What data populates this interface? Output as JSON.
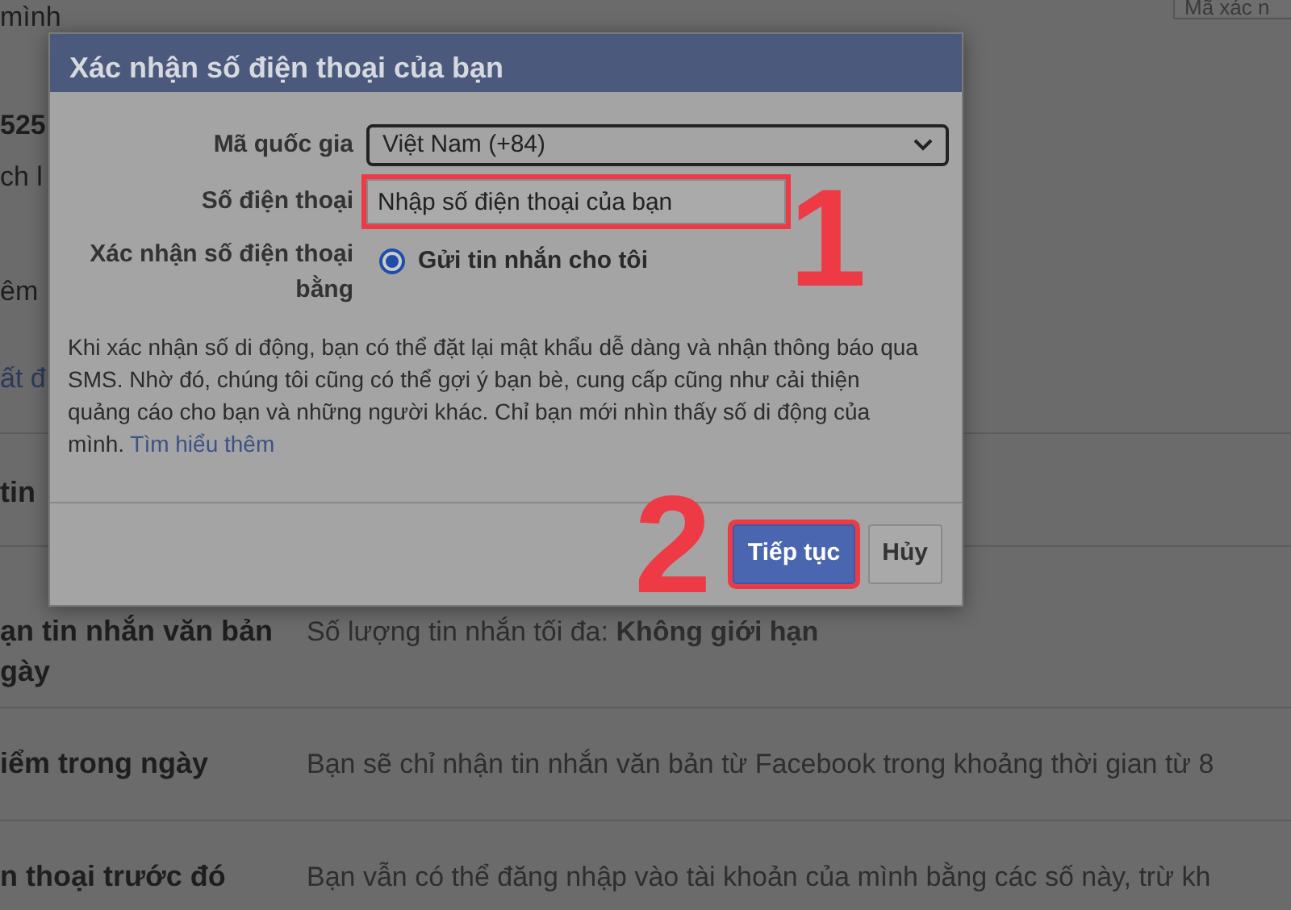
{
  "background": {
    "top_field": "Mã xác n",
    "fragments": [
      {
        "text": "mình",
        "kind": "plain"
      },
      {
        "text": "525",
        "kind": "bold"
      },
      {
        "text": "ch l",
        "kind": "plain"
      },
      {
        "text": "êm",
        "kind": "plain"
      },
      {
        "text": "ất đ",
        "kind": "link"
      }
    ],
    "rows": [
      {
        "label": "tin",
        "description": ""
      },
      {
        "label": "ạn tin nhắn văn bản\ngày",
        "description": "Số lượng tin nhắn tối đa: **Không giới hạn**"
      },
      {
        "label": "iểm trong ngày",
        "description": "Bạn sẽ chỉ nhận tin nhắn văn bản từ Facebook trong khoảng thời gian từ 8"
      },
      {
        "label": "n thoại trước đó",
        "description": "Bạn vẫn có thể đăng nhập vào tài khoản của mình bằng các số này, trừ kh"
      }
    ]
  },
  "dialog": {
    "title": "Xác nhận số điện thoại của bạn",
    "country": {
      "label": "Mã quốc gia",
      "value": "Việt Nam (+84)"
    },
    "phone": {
      "label": "Số điện thoại",
      "placeholder": "Nhập số điện thoại của bạn",
      "highlighted": true,
      "step": "1"
    },
    "method": {
      "label": "Xác nhận số điện thoại bằng",
      "option": "Gửi tin nhắn cho tôi",
      "selected": true
    },
    "info": "Khi xác nhận số di động, bạn có thể đặt lại mật khẩu dễ dàng và nhận thông báo qua SMS. Nhờ đó, chúng tôi cũng có thể gợi ý bạn bè, cung cấp cũng như cải thiện quảng cáo cho bạn và những người khác. Chỉ bạn mới nhìn thấy số di động của mình.",
    "learn_more": "Tìm hiểu thêm",
    "buttons": [
      {
        "label": "Tiếp tục",
        "kind": "primary",
        "highlighted": true,
        "step": "2"
      },
      {
        "label": "Hủy",
        "kind": "secondary",
        "highlighted": false
      }
    ]
  }
}
